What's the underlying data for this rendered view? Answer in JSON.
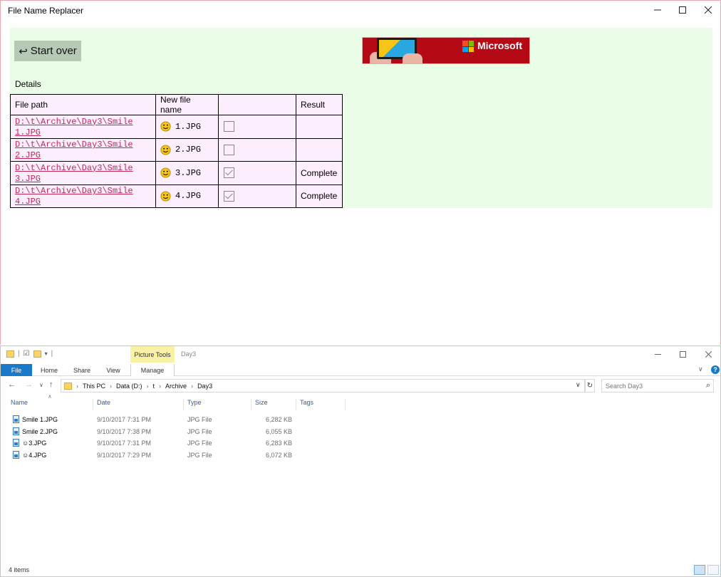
{
  "app": {
    "title": "File Name Replacer",
    "start_over_label": "Start over",
    "start_over_icon": "return-arrow-icon",
    "banner": {
      "text": "Microsoft",
      "colors": {
        "bg": "#b50a15",
        "logo": [
          "#f25022",
          "#7fba00",
          "#00a4ef",
          "#ffb900"
        ]
      }
    },
    "details_label": "Details",
    "table": {
      "headers": [
        "File path",
        "New file name",
        "",
        "Result"
      ],
      "rows": [
        {
          "path": "D:\\t\\Archive\\Day3\\Smile 1.JPG",
          "new_name": "1.JPG",
          "checked": false,
          "result": ""
        },
        {
          "path": "D:\\t\\Archive\\Day3\\Smile 2.JPG",
          "new_name": "2.JPG",
          "checked": false,
          "result": ""
        },
        {
          "path": "D:\\t\\Archive\\Day3\\Smile 3.JPG",
          "new_name": "3.JPG",
          "checked": true,
          "result": "Complete"
        },
        {
          "path": "D:\\t\\Archive\\Day3\\Smile 4.JPG",
          "new_name": "4.JPG",
          "checked": true,
          "result": "Complete"
        }
      ]
    },
    "colors": {
      "content_bg": "#eafde7",
      "table_bg": "#fdeefd",
      "link": "#c02a55",
      "button_bg": "#b5c9b5"
    }
  },
  "explorer": {
    "context_tab": "Picture Tools",
    "folder_title": "Day3",
    "ribbon_tabs": [
      "File",
      "Home",
      "Share",
      "View",
      "Manage"
    ],
    "breadcrumbs": [
      "This PC",
      "Data (D:)",
      "t",
      "Archive",
      "Day3"
    ],
    "search_placeholder": "Search Day3",
    "columns": [
      "Name",
      "Date",
      "Type",
      "Size",
      "Tags"
    ],
    "files": [
      {
        "name": "Smile 1.JPG",
        "date": "9/10/2017 7:31 PM",
        "type": "JPG File",
        "size": "6,282 KB"
      },
      {
        "name": "Smile 2.JPG",
        "date": "9/10/2017 7:38 PM",
        "type": "JPG File",
        "size": "6,055 KB"
      },
      {
        "name": "☺3.JPG",
        "date": "9/10/2017 7:31 PM",
        "type": "JPG File",
        "size": "6,283 KB"
      },
      {
        "name": "☺4.JPG",
        "date": "9/10/2017 7:29 PM",
        "type": "JPG File",
        "size": "6,072 KB"
      }
    ],
    "status": "4 items",
    "colors": {
      "file_tab": "#1979ca",
      "context_tab": "#f9f1a5",
      "header_text": "#3b5998"
    }
  }
}
